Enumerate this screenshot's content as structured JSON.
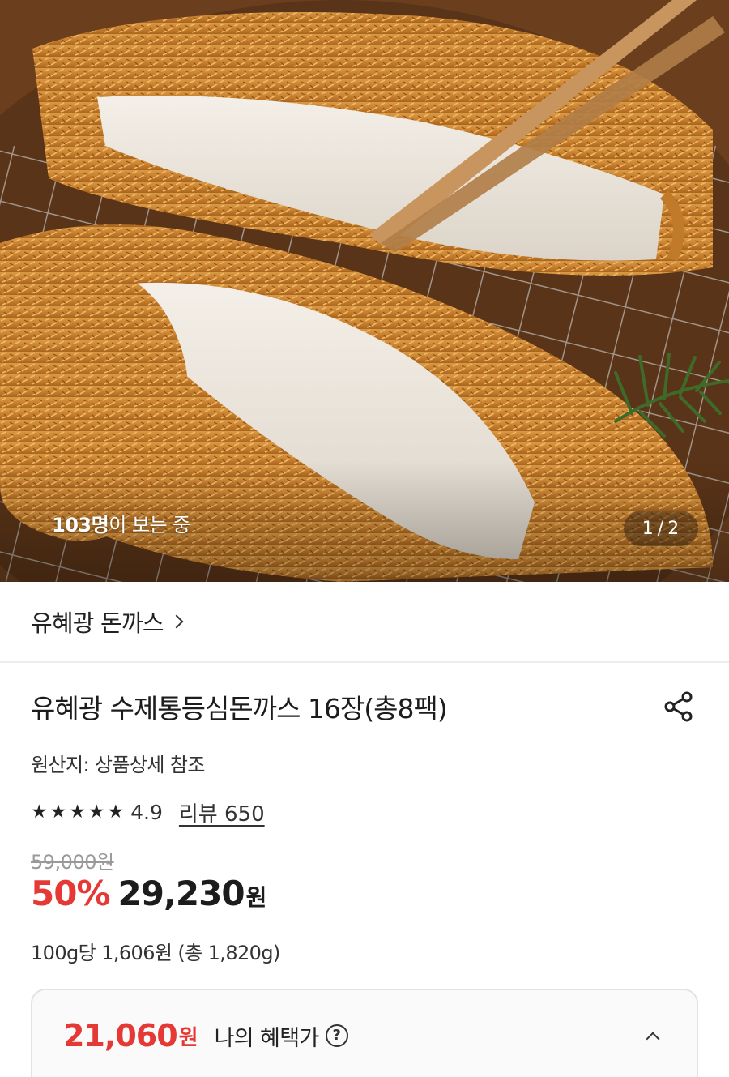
{
  "hero": {
    "viewers_count": "103명",
    "viewers_suffix": "이 보는 중",
    "page_current": "1",
    "page_total": "2"
  },
  "brand": {
    "name": "유혜광 돈까스"
  },
  "product": {
    "title": "유혜광 수제통등심돈까스 16장(총8팩)",
    "origin": "원산지: 상품상세 참조",
    "rating": "4.9",
    "stars": 5,
    "review_label": "리뷰 650",
    "original_price": "59,000원",
    "discount_rate": "50%",
    "sale_price": "29,230",
    "currency": "원",
    "unit_price": "100g당 1,606원 (총 1,820g)"
  },
  "benefit": {
    "price": "21,060",
    "currency": "원",
    "label": "나의 혜택가",
    "help_glyph": "?"
  },
  "colors": {
    "accent_red": "#e53935",
    "text_dark": "#222222",
    "divider": "#ececec"
  },
  "icons": {
    "share": "share-icon",
    "help": "help-circle-icon",
    "collapse": "chevron-up-icon",
    "brand_link": "chevron-right-icon",
    "star": "star-icon"
  }
}
